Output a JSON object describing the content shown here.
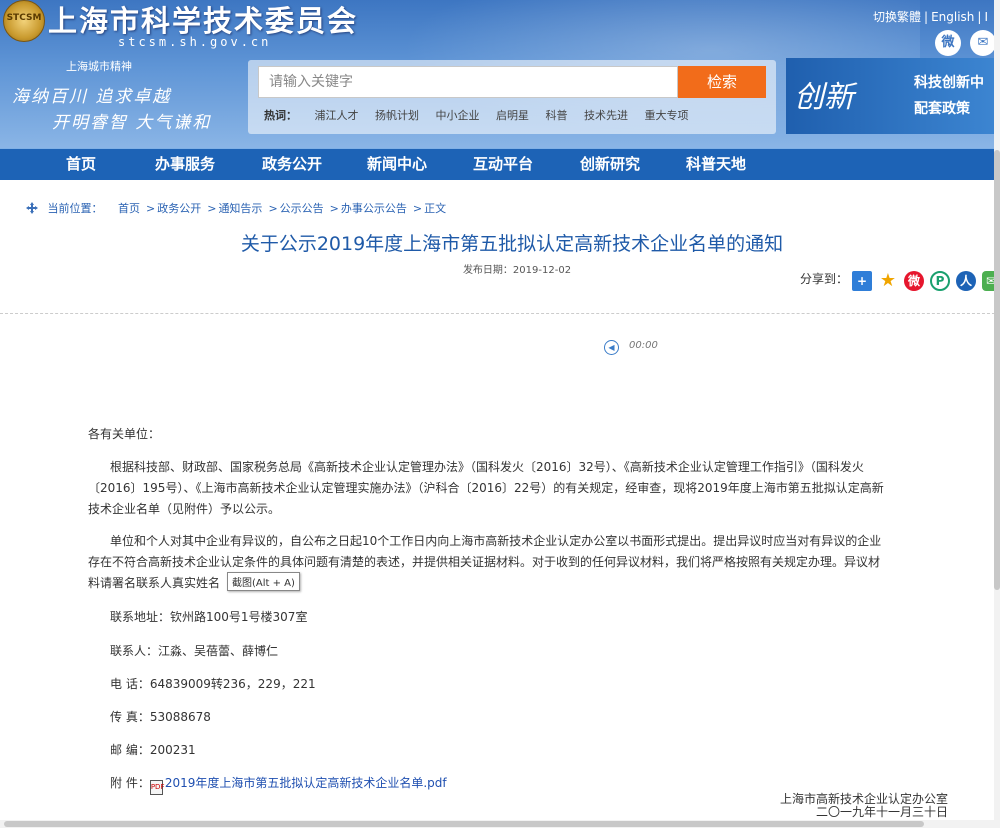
{
  "header": {
    "site_name": "上海市科学技术委员会",
    "site_url": "stcsm.sh.gov.cn",
    "emblem_text": "STCSM",
    "lang_traditional": "切换繁體",
    "lang_english": "English",
    "lang_more": "I",
    "spirit_title": "上海城市精神",
    "spirit_line1": "海纳百川  追求卓越",
    "spirit_line2": "开明睿智  大气谦和",
    "search_placeholder": "请输入关键字",
    "search_button": "检索",
    "hot_label": "热词：",
    "hot_words": [
      "浦江人才",
      "扬帆计划",
      "中小企业",
      "启明星",
      "科普",
      "技术先进",
      "重大专项"
    ],
    "banner_big": "创新",
    "banner_line1": "科技创新中",
    "banner_line2": "配套政策"
  },
  "nav": [
    "首页",
    "办事服务",
    "政务公开",
    "新闻中心",
    "互动平台",
    "创新研究",
    "科普天地"
  ],
  "breadcrumb": {
    "label": "当前位置：",
    "items": [
      "首页",
      "政务公开",
      "通知告示",
      "公示公告",
      "办事公示公告",
      "正文"
    ]
  },
  "article": {
    "title": "关于公示2019年度上海市第五批拟认定高新技术企业名单的通知",
    "publish_date": "发布日期：2019-12-02",
    "share_label": "分享到：",
    "audio_time": "00:00",
    "salutation": "各有关单位：",
    "para1_line1": "根据科技部、财政部、国家税务总局《高新技术企业认定管理办法》（国科发火〔2016〕32号）、《高新技术企业认定管理工作指引》（国科发火",
    "para1_line2": "〔2016〕195号）、《上海市高新技术企业认定管理实施办法》（沪科合〔2016〕22号）的有关规定，经审查，现将2019年度上海市第五批拟认定高新",
    "para1_line3": "技术企业名单（见附件）予以公示。",
    "para2_line1": "单位和个人对其中企业有异议的，自公布之日起10个工作日内向上海市高新技术企业认定办公室以书面形式提出。提出异议时应当对有异议的企业",
    "para2_line2": "存在不符合高新技术企业认定条件的具体问题有清楚的表述，并提供相关证据材料。对于收到的任何异议材料，我们将严格按照有关规定办理。异议材",
    "para2_line3": "料请署名联系人真实姓名",
    "tooltip": "截图(Alt + A)",
    "address": "联系地址：钦州路100号1号楼307室",
    "contacts": "联系人：江淼、吴蓓蕾、薛博仁",
    "phone": "电  话：64839009转236，229，221",
    "fax": "传  真：53088678",
    "postcode": "邮  编：200231",
    "attachment_label": "附  件：",
    "attachment_link": "2019年度上海市第五批拟认定高新技术企业名单.pdf",
    "sign_org": "上海市高新技术企业认定办公室",
    "sign_date": "二〇一九年十一月三十日"
  },
  "colors": {
    "nav_bg": "#1d63b6",
    "title": "#1f5aa8",
    "search_button": "#f26c1a"
  }
}
